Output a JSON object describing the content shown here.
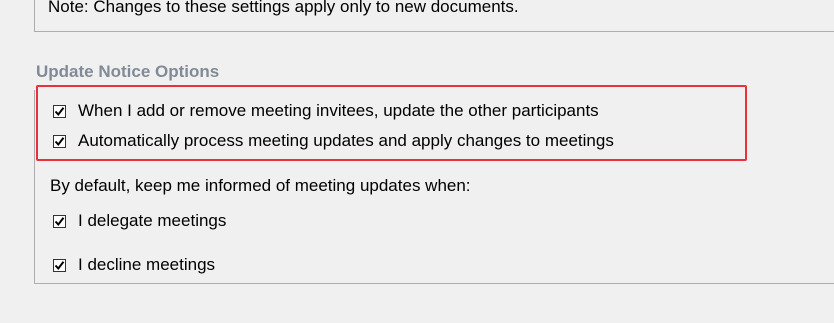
{
  "top_section": {
    "note": "Note:  Changes to these settings apply only to new documents."
  },
  "update_notice": {
    "title": "Update Notice Options",
    "options": [
      {
        "label": "When I add or remove meeting invitees, update the other participants",
        "checked": true
      },
      {
        "label": "Automatically process meeting updates and apply changes to meetings",
        "checked": true
      }
    ],
    "default_text": "By default, keep me informed of meeting updates when:",
    "inform_options": [
      {
        "label": "I delegate meetings",
        "checked": true
      },
      {
        "label": "I decline meetings",
        "checked": true
      }
    ],
    "highlight_color": "#e8313a"
  }
}
